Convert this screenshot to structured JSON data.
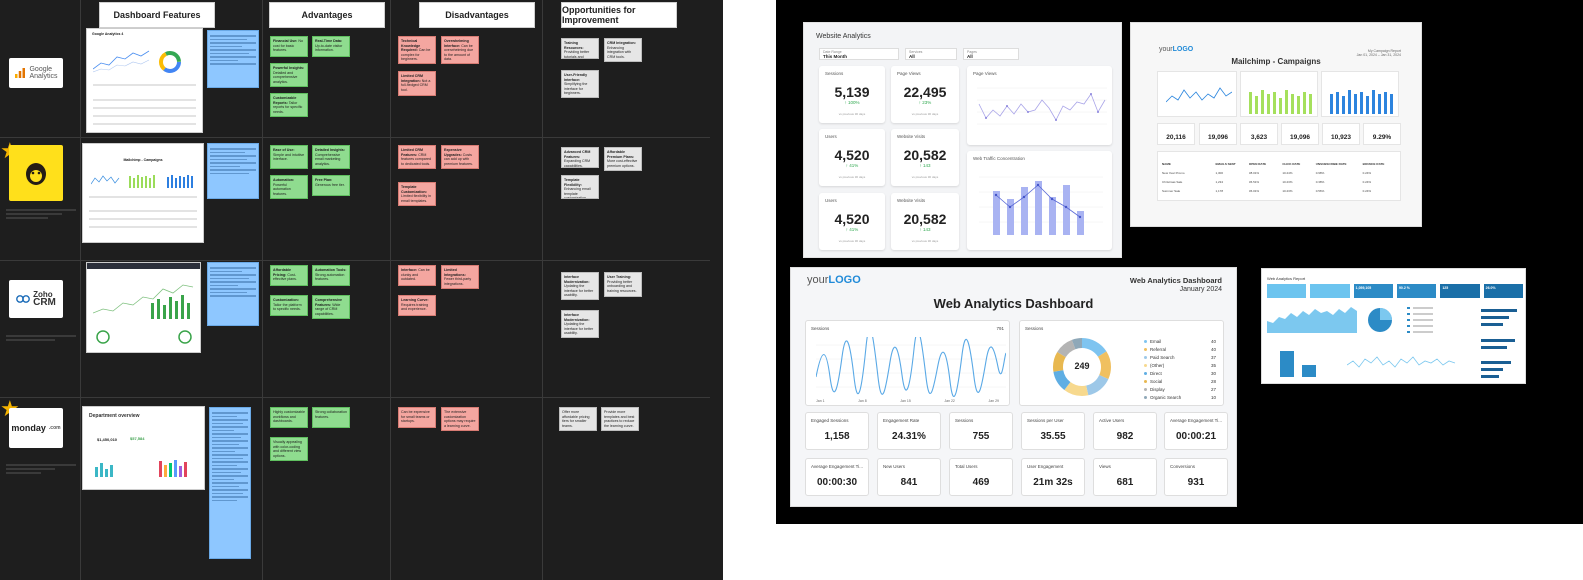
{
  "board": {
    "headers": [
      "Dashboard Features",
      "Advantages",
      "Disadvantages",
      "Opportunities for Improvement"
    ],
    "tools": [
      {
        "name": "Google Analytics",
        "logo_text_1": "Google",
        "logo_text_2": "Analytics"
      },
      {
        "name": "Mailchimp",
        "logo_text_1": "",
        "logo_text_2": ""
      },
      {
        "name": "Zoho CRM",
        "logo_text_1": "Zoho",
        "logo_text_2": "CRM"
      },
      {
        "name": "monday.com",
        "logo_text_1": "monday",
        "logo_text_2": ".com"
      }
    ],
    "thumb_titles": [
      "Google Analytics 4",
      "Mailchimp - Campaigns",
      "",
      "Department overview"
    ],
    "monday_stats": [
      "$1,450,010",
      "$57,584",
      ""
    ],
    "advantages": [
      [
        [
          "Financial Use:",
          "No cost for basic features."
        ],
        [
          "Real-Time Data:",
          "Up-to-date visitor information."
        ],
        [
          "Powerful Insights:",
          "Detailed and comprehensive analytics."
        ],
        [
          "Customizable Reports:",
          "Tailor reports for specific needs."
        ]
      ],
      [
        [
          "Ease of Use:",
          "Simple and intuitive interface."
        ],
        [
          "Detailed Insights:",
          "Comprehensive email marketing analytics."
        ],
        [
          "Automation:",
          "Powerful automation features."
        ],
        [
          "Free Plan:",
          "Generous free tier."
        ]
      ],
      [
        [
          "Affordable Pricing:",
          "Cost-effective plans."
        ],
        [
          "Automation Tools:",
          "Strong automation features."
        ],
        [
          "Customization:",
          "Tailor the platform to specific needs."
        ],
        [
          "Comprehensive Features:",
          "Wide range of CRM capabilities."
        ]
      ],
      [
        [
          "",
          "Highly customizable workflows and dashboards."
        ],
        [
          "",
          "Strong collaboration features."
        ],
        [
          "",
          "Visually appealing with color-coding and different view options."
        ]
      ]
    ],
    "disadvantages": [
      [
        [
          "Technical Knowledge Required:",
          "Can be complex for beginners."
        ],
        [
          "Overwhelming Interface:",
          "Can be overwhelming due to the amount of data."
        ],
        [
          "Limited CRM Integration:",
          "Not a full-fledged CRM tool."
        ]
      ],
      [
        [
          "Limited CRM Features:",
          "CRM features compared to dedicated tools."
        ],
        [
          "Expensive Upgrades:",
          "Costs can add up with premium features."
        ],
        [
          "Template Customization:",
          "Limited flexibility in email templates."
        ]
      ],
      [
        [
          "Interface:",
          "Can be clunky and outdated."
        ],
        [
          "Limited Integrations:",
          "Fewer third-party integrations."
        ],
        [
          "Learning Curve:",
          "Requires training and experience."
        ]
      ],
      [
        [
          "",
          "Can be expensive for small teams or startups."
        ],
        [
          "",
          "The extensive customization options may require a learning curve."
        ]
      ]
    ],
    "opportunities": [
      [
        [
          "Training Resources:",
          "Providing better tutorials and guides."
        ],
        [
          "CRM Integration:",
          "Enhancing integration with CRM tools."
        ],
        [
          "User-Friendly Interface:",
          "Simplifying the interface for beginners."
        ]
      ],
      [
        [
          "Advanced CRM Features:",
          "Expanding CRM capabilities."
        ],
        [
          "Affordable Premium Plans:",
          "More cost-effective premium options."
        ],
        [
          "Template Flexibility:",
          "Enhancing email template customization."
        ]
      ],
      [
        [
          "Interface Modernization:",
          "Updating the interface for better usability."
        ],
        [
          "User Training:",
          "Providing better onboarding and training resources."
        ],
        [
          "Interface Modernization:",
          "Updating the interface for better usability."
        ]
      ],
      [
        [
          "",
          "Offer more affordable pricing tiers for smaller teams."
        ],
        [
          "",
          "Provide more templates and best practices to reduce the learning curve."
        ]
      ]
    ]
  },
  "website_analytics": {
    "title": "Website Analytics",
    "filters": [
      {
        "label": "Date Range",
        "value": "This Month"
      },
      {
        "label": "Services",
        "value": "All"
      },
      {
        "label": "Pages",
        "value": "All"
      }
    ],
    "metrics": [
      {
        "label": "Sessions",
        "value": "5,139",
        "delta": "↑ 100%",
        "sub": "vs previous 30 days"
      },
      {
        "label": "Page Views",
        "value": "22,495",
        "delta": "↑ 23%",
        "sub": "vs previous 30 days"
      },
      {
        "label": "Users",
        "value": "4,520",
        "delta": "↑ 41%",
        "sub": "vs previous 30 days"
      },
      {
        "label": "Website Visits",
        "value": "20,582",
        "delta": "↑ 143",
        "sub": "vs previous 30 days"
      },
      {
        "label": "Users",
        "value": "4,520",
        "delta": "↑ 41%",
        "sub": "vs previous 30 days"
      },
      {
        "label": "Website Visits",
        "value": "20,582",
        "delta": "↑ 143",
        "sub": "vs previous 30 days"
      }
    ],
    "chart_titles": [
      "Page Views",
      "Web Traffic Concentration"
    ]
  },
  "mailchimp": {
    "logo_prefix": "your",
    "logo_main": "LOGO",
    "title": "Mailchimp - Campaigns",
    "report_label": "My Campaign Report",
    "date_range": "Jan 01, 2024 – Jan 31, 2024",
    "stats": [
      "20,116",
      "19,096",
      "3,623",
      "19,096",
      "10,923",
      "9.29%"
    ],
    "table_headers": [
      "NAME",
      "EMAILS SENT",
      "OPEN RATE",
      "CLICK RATE",
      "UNSUBSCRIBE RATE",
      "BOUNCE RATE"
    ],
    "table_rows": [
      [
        "New Year Promo",
        "1,300",
        "38.01%",
        "10.24%",
        "0.98%",
        "0.24%"
      ],
      [
        "Christmas Sale",
        "1,234",
        "36.51%",
        "10.23%",
        "0.38%",
        "0.24%"
      ],
      [
        "Summer Sale",
        "1,178",
        "36.01%",
        "10.23%",
        "0.56%",
        "0.24%"
      ]
    ]
  },
  "wa_dashboard": {
    "logo_prefix": "your",
    "logo_main": "LOGO",
    "header_title": "Web Analytics Dashboard",
    "header_date": "January 2024",
    "title": "Web Analytics Dashboard",
    "line_title": "Sessions",
    "line_total": "791",
    "donut_title": "Sessions",
    "donut_center": "249",
    "legend": [
      {
        "name": "Email",
        "value": "40",
        "color": "#7ec4f0"
      },
      {
        "name": "Referral",
        "value": "40",
        "color": "#f0c060"
      },
      {
        "name": "Paid Search",
        "value": "37",
        "color": "#9dc8e8"
      },
      {
        "name": "(Other)",
        "value": "35",
        "color": "#f7d98e"
      },
      {
        "name": "Direct",
        "value": "30",
        "color": "#5faee3"
      },
      {
        "name": "Social",
        "value": "28",
        "color": "#e8b850"
      },
      {
        "name": "Display",
        "value": "27",
        "color": "#b4b4b4"
      },
      {
        "name": "Organic Search",
        "value": "10",
        "color": "#8fa8b8"
      }
    ],
    "x_labels": [
      "Jan 1",
      "Jan 8",
      "Jan 15",
      "Jan 22",
      "Jan 29"
    ],
    "cards": [
      {
        "label": "Engaged Sessions",
        "value": "1,158"
      },
      {
        "label": "Engagement Rate",
        "value": "24.31%"
      },
      {
        "label": "Sessions",
        "value": "755"
      },
      {
        "label": "Sessions per User",
        "value": "35.55"
      },
      {
        "label": "Active Users",
        "value": "982"
      },
      {
        "label": "Average Engagement Ti...",
        "value": "00:00:21"
      },
      {
        "label": "Average Engagement Ti...",
        "value": "00:00:30"
      },
      {
        "label": "New Users",
        "value": "841"
      },
      {
        "label": "Total Users",
        "value": "469"
      },
      {
        "label": "User Engagement",
        "value": "21m 32s"
      },
      {
        "label": "Views",
        "value": "681"
      },
      {
        "label": "Conversions",
        "value": "931"
      }
    ]
  },
  "web_report": {
    "title": "Web Analytics Report",
    "kpis": [
      "",
      "",
      "1,059,105",
      "90.2 %",
      "125",
      "26.0%"
    ]
  },
  "colors": {
    "accent_blue": "#3b8fe0",
    "advantage_green": "#8fdc8f",
    "disadvantage_red": "#f4a6a0",
    "opportunity_gray": "#e6e6e6",
    "feature_blue": "#8ec7ff"
  }
}
